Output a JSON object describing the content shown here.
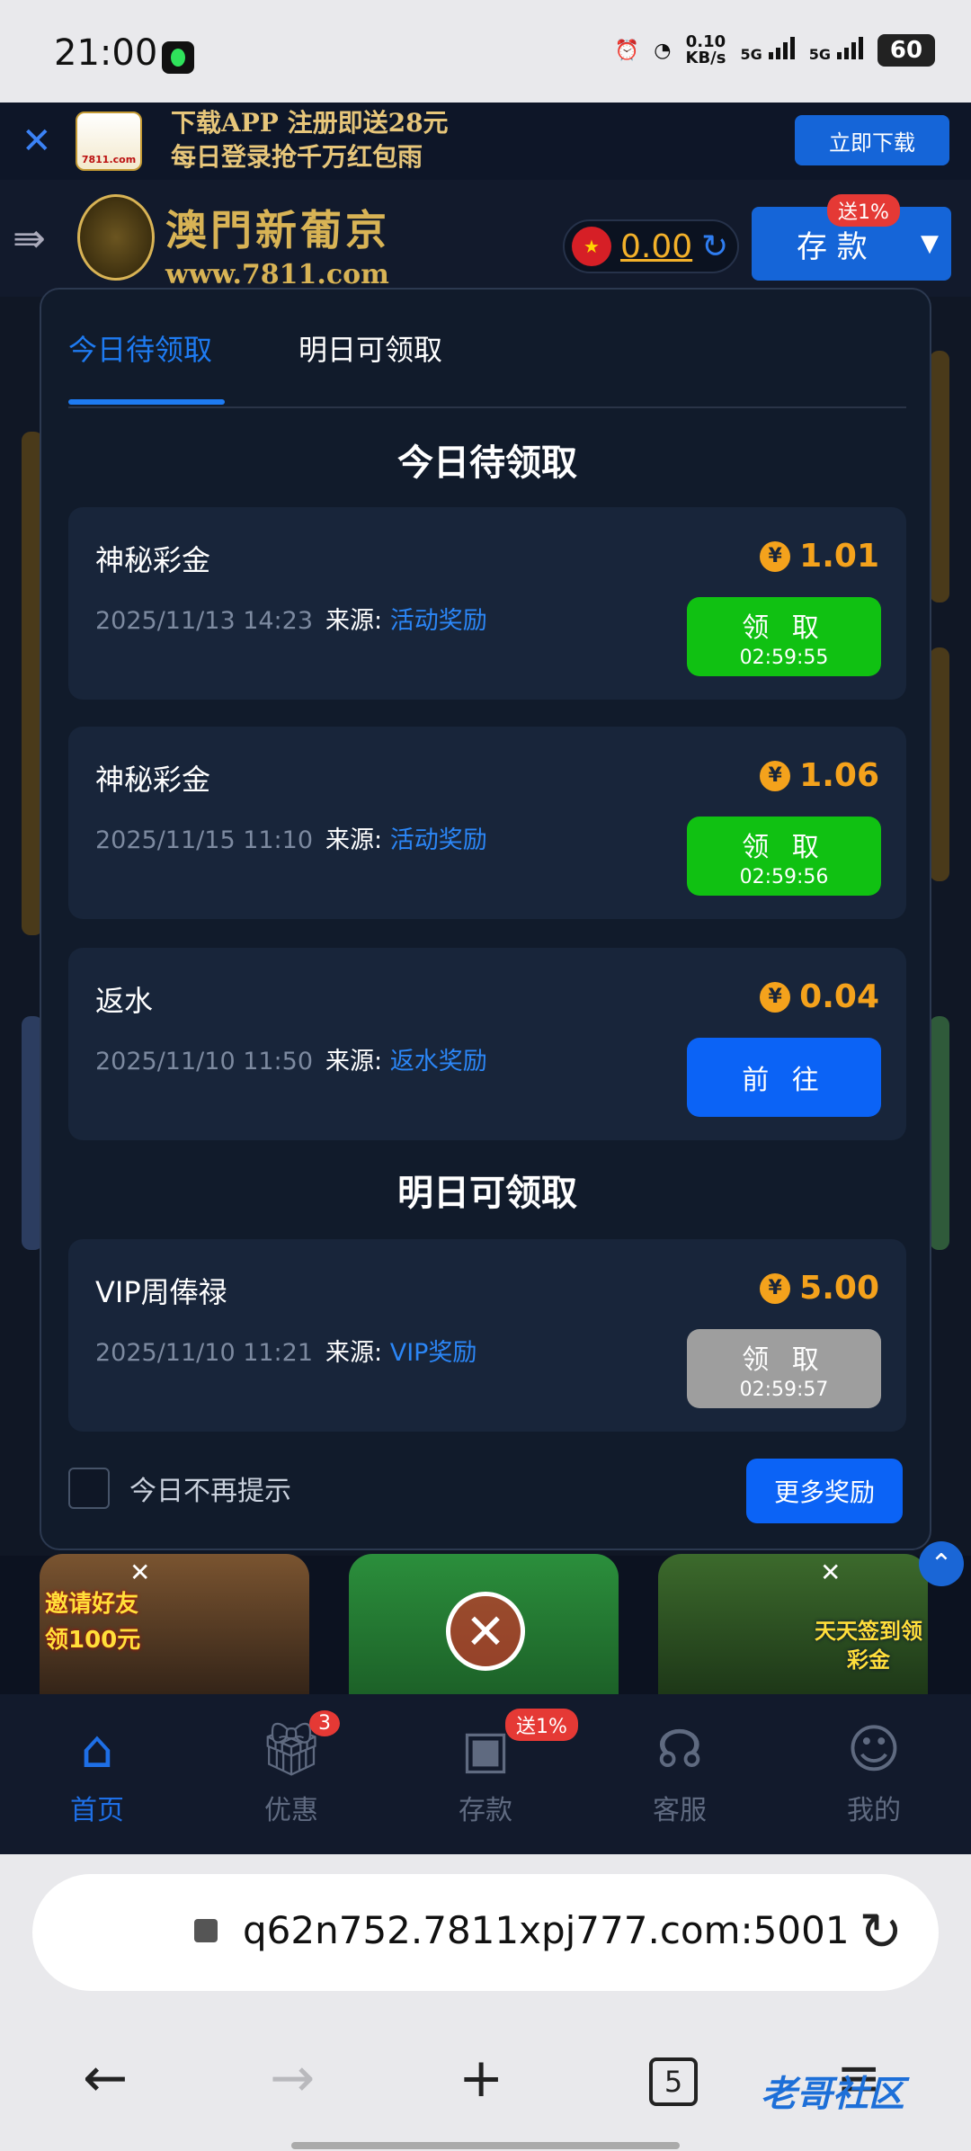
{
  "status_bar": {
    "time": "21:00",
    "speed_value": "0.10",
    "speed_unit": "KB/s",
    "sig1": "5G",
    "sig2": "5G",
    "battery": "60"
  },
  "download_bar": {
    "logo_text": "7811.com",
    "promo_line1": "下载APP 注册即送28元",
    "promo_line2": "每日登录抢千万红包雨",
    "button": "立即下载"
  },
  "header": {
    "brand_name": "澳門新葡京",
    "brand_url": "www.7811.com",
    "balance": "0.00",
    "deposit_label": "存 款",
    "deposit_badge": "送1%"
  },
  "modal": {
    "tabs": [
      {
        "label": "今日待领取"
      },
      {
        "label": "明日可领取"
      }
    ],
    "today_title": "今日待领取",
    "tomorrow_title": "明日可领取",
    "source_label": "来源:",
    "today_items": [
      {
        "name": "神秘彩金",
        "amount": "1.01",
        "datetime": "2025/11/13 14:23",
        "source": "活动奖励",
        "action": "领 取",
        "countdown": "02:59:55"
      },
      {
        "name": "神秘彩金",
        "amount": "1.06",
        "datetime": "2025/11/15 11:10",
        "source": "活动奖励",
        "action": "领 取",
        "countdown": "02:59:56"
      },
      {
        "name": "返水",
        "amount": "0.04",
        "datetime": "2025/11/10 11:50",
        "source": "返水奖励",
        "action": "前 往",
        "countdown": ""
      }
    ],
    "tomorrow_items": [
      {
        "name": "VIP周俸禄",
        "amount": "5.00",
        "datetime": "2025/11/10 11:21",
        "source": "VIP奖励",
        "action": "领 取",
        "countdown": "02:59:57"
      }
    ],
    "dont_show_today": "今日不再提示",
    "more_rewards": "更多奖励",
    "currency_symbol": "¥"
  },
  "games": {
    "g1_promo": "邀请好友",
    "g1_promo2": "领100元",
    "g3_promo": "天天签到领",
    "g3_promo2": "彩金"
  },
  "bottom_nav": [
    {
      "label": "首页",
      "icon": "home-icon"
    },
    {
      "label": "优惠",
      "icon": "gift-icon",
      "badge": "3"
    },
    {
      "label": "存款",
      "icon": "wallet-icon",
      "badge": "送1%"
    },
    {
      "label": "客服",
      "icon": "headset-icon"
    },
    {
      "label": "我的",
      "icon": "user-icon"
    }
  ],
  "browser": {
    "url": "q62n752.7811xpj777.com:5001",
    "tab_count": "5",
    "watermark": "老哥社区"
  },
  "colors": {
    "accent_blue": "#1e7bf2",
    "claim_green": "#10c112",
    "amount_orange": "#f4a21c",
    "disabled_gray": "#9e9e9e"
  }
}
